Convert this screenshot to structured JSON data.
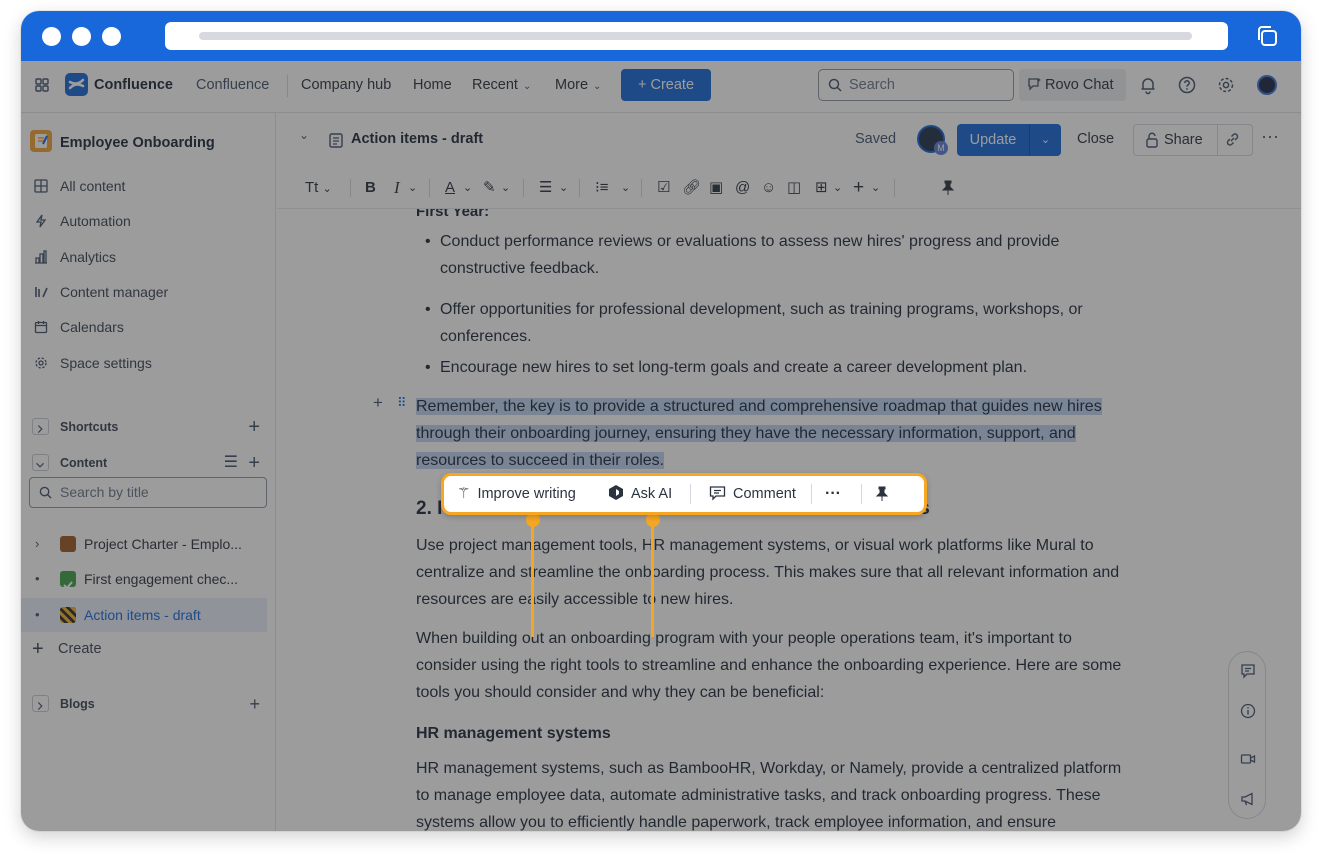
{
  "browser": {
    "accent": "#1868db"
  },
  "topnav": {
    "brand": "Confluence",
    "items": [
      {
        "label": "Confluence",
        "chevron": false
      },
      {
        "label": "Company hub",
        "chevron": false
      },
      {
        "label": "Home",
        "chevron": false
      },
      {
        "label": "Recent",
        "chevron": true
      },
      {
        "label": "More",
        "chevron": true
      }
    ],
    "create_label": "+ Create",
    "search_placeholder": "Search",
    "rovo_label": "Rovo Chat"
  },
  "sidebar": {
    "space_title": "Employee Onboarding",
    "items": [
      {
        "label": "All content",
        "icon": "grid-icon"
      },
      {
        "label": "Automation",
        "icon": "bolt-icon"
      },
      {
        "label": "Analytics",
        "icon": "bar-chart-icon"
      },
      {
        "label": "Content manager",
        "icon": "content-manager-icon"
      },
      {
        "label": "Calendars",
        "icon": "calendar-icon"
      },
      {
        "label": "Space settings",
        "icon": "gear-icon"
      }
    ],
    "shortcuts_label": "Shortcuts",
    "content_label": "Content",
    "search_placeholder": "Search by title",
    "tree": [
      {
        "label": "Project Charter - Emplo...",
        "emoji": "briefcase"
      },
      {
        "label": "First engagement chec...",
        "emoji": "check"
      },
      {
        "label": "Action items - draft",
        "emoji": "construction"
      }
    ],
    "create_label": "Create",
    "blogs_label": "Blogs"
  },
  "header": {
    "page_title": "Action items - draft",
    "saved": "Saved",
    "update": "Update",
    "close": "Close",
    "share": "Share",
    "avatar_badge": "M"
  },
  "toolbar": {
    "text_style": "Tt"
  },
  "doc": {
    "partial_heading": "First Year:",
    "bullets": [
      "Conduct performance reviews or evaluations to assess new hires' progress and provide constructive feedback.",
      "Offer opportunities for professional development, such as training programs, workshops, or conferences.",
      "Encourage new hires to set long-term goals and create a career development plan."
    ],
    "selected_paragraph_lines": [
      "Remember, the key is to provide a structured and comprehensive roadmap that guides new hires",
      "through their onboarding journey, ensuring they have the necessary information, support, and",
      "resources to succeed in their roles."
    ],
    "section_heading_start": "2. I",
    "section_heading_end": "ls",
    "para1_lines": [
      "Use project management tools, HR management systems, or visual work platforms like Mural to",
      "centralize and streamline the onboarding process. This makes sure that all relevant information and",
      "resources are easily accessible to new hires."
    ],
    "para2_lines": [
      "When building out an onboarding program with your people operations team, it's important to",
      "consider using the right tools to streamline and enhance the onboarding experience. Here are some",
      "tools you should consider and why they can be beneficial:"
    ],
    "subheading": "HR management systems",
    "para3_lines": [
      "HR management systems, such as BambooHR, Workday, or Namely, provide a centralized platform",
      "to manage employee data, automate administrative tasks, and track onboarding progress. These",
      "systems allow you to efficiently handle paperwork, track employee information, and ensure"
    ]
  },
  "floating_toolbar": {
    "improve_writing": "Improve writing",
    "ask_ai": "Ask AI",
    "comment": "Comment",
    "more": "···",
    "highlight_color": "#f5a623"
  }
}
